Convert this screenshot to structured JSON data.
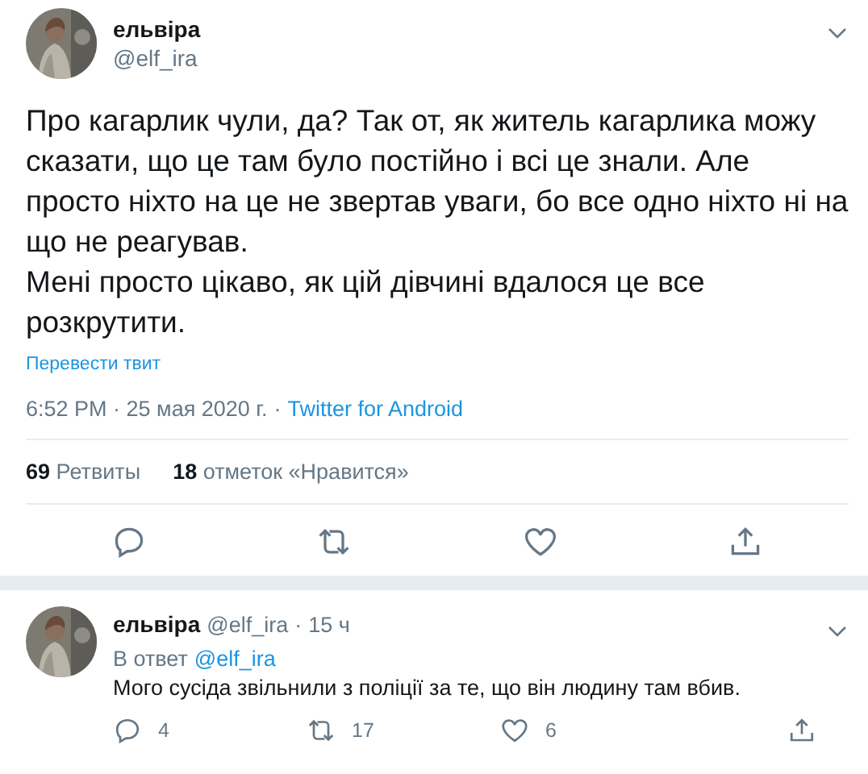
{
  "tweet": {
    "author": {
      "name": "ельвіра",
      "handle": "@elf_ira"
    },
    "paragraphs": [
      "Про кагарлик чули, да? Так от, як житель кагарлика можу сказати, що це там було постійно і всі це знали. Але просто ніхто на це не звертав уваги, бо все одно ніхто ні на що не реагував.",
      "Мені просто цікаво, як цій дівчині вдалося це все розкрутити."
    ],
    "translate_link": "Перевести твит",
    "timestamp": "6:52 PM · 25 мая 2020 г.",
    "separator": "·",
    "source": "Twitter for Android",
    "stats": [
      {
        "count": "69",
        "label": "Ретвиты"
      },
      {
        "count": "18",
        "label": "отметок «Нравится»"
      }
    ]
  },
  "reply": {
    "author": {
      "name": "ельвіра",
      "handle": "@elf_ira"
    },
    "separator": "·",
    "time": "15 ч",
    "reply_to_label": "В ответ",
    "reply_to_handle": "@elf_ira",
    "text": "Мого сусіда звільнили з поліції за те, що він людину там вбив.",
    "actions": [
      {
        "kind": "reply",
        "count": "4"
      },
      {
        "kind": "retweet",
        "count": "17"
      },
      {
        "kind": "like",
        "count": "6"
      },
      {
        "kind": "share"
      }
    ]
  }
}
